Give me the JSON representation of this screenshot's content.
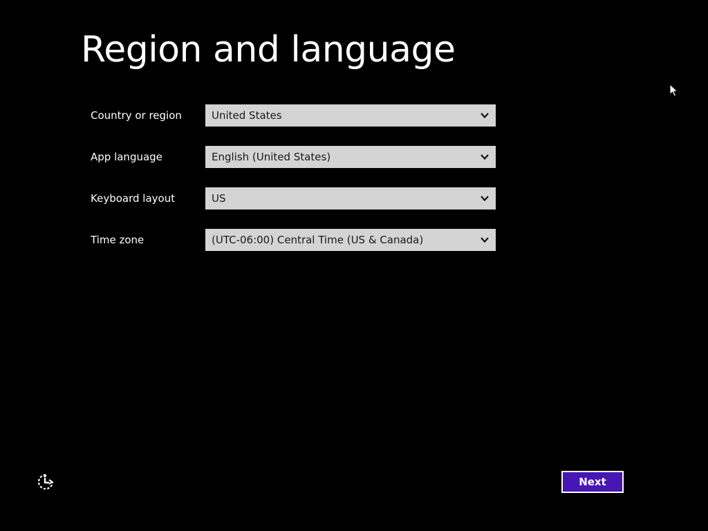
{
  "page": {
    "title": "Region and language"
  },
  "form": {
    "fields": [
      {
        "label": "Country or region",
        "value": "United States"
      },
      {
        "label": "App language",
        "value": "English (United States)"
      },
      {
        "label": "Keyboard layout",
        "value": "US"
      },
      {
        "label": "Time zone",
        "value": "(UTC-06:00) Central Time (US & Canada)"
      }
    ]
  },
  "footer": {
    "ease_of_access_icon": "ease-of-access-icon",
    "next_label": "Next"
  },
  "colors": {
    "background": "#000000",
    "select_background": "#d4d4d4",
    "accent": "#4617b4",
    "text": "#ffffff"
  }
}
